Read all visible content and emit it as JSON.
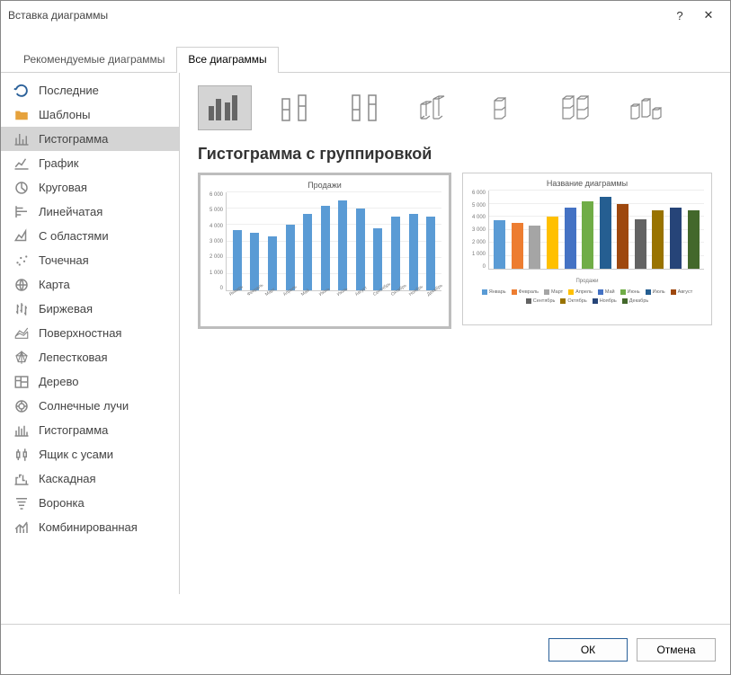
{
  "window": {
    "title": "Вставка диаграммы"
  },
  "tabs": {
    "recommended": "Рекомендуемые диаграммы",
    "all": "Все диаграммы"
  },
  "sidebar": {
    "items": [
      {
        "label": "Последние",
        "icon": "recent"
      },
      {
        "label": "Шаблоны",
        "icon": "templates"
      },
      {
        "label": "Гистограмма",
        "icon": "column",
        "selected": true
      },
      {
        "label": "График",
        "icon": "line"
      },
      {
        "label": "Круговая",
        "icon": "pie"
      },
      {
        "label": "Линейчатая",
        "icon": "bar"
      },
      {
        "label": "С областями",
        "icon": "area"
      },
      {
        "label": "Точечная",
        "icon": "scatter"
      },
      {
        "label": "Карта",
        "icon": "map"
      },
      {
        "label": "Биржевая",
        "icon": "stock"
      },
      {
        "label": "Поверхностная",
        "icon": "surface"
      },
      {
        "label": "Лепестковая",
        "icon": "radar"
      },
      {
        "label": "Дерево",
        "icon": "treemap"
      },
      {
        "label": "Солнечные лучи",
        "icon": "sunburst"
      },
      {
        "label": "Гистограмма",
        "icon": "histogram"
      },
      {
        "label": "Ящик с усами",
        "icon": "boxwhisker"
      },
      {
        "label": "Каскадная",
        "icon": "waterfall"
      },
      {
        "label": "Воронка",
        "icon": "funnel"
      },
      {
        "label": "Комбинированная",
        "icon": "combo"
      }
    ]
  },
  "main": {
    "subtype_title": "Гистограмма с группировкой",
    "preview1_title": "Продажи",
    "preview2_title": "Название диаграммы",
    "preview2_xlabel": "Продажи"
  },
  "footer": {
    "ok": "ОК",
    "cancel": "Отмена"
  },
  "chart_data": [
    {
      "type": "bar",
      "title": "Продажи",
      "categories": [
        "Январь",
        "Февраль",
        "Март",
        "Апрель",
        "Май",
        "Июнь",
        "Июль",
        "Август",
        "Сентябрь",
        "Октябрь",
        "Ноябрь",
        "Декабрь"
      ],
      "values": [
        3700,
        3500,
        3300,
        4000,
        4700,
        5200,
        5500,
        5000,
        3800,
        4500,
        4700,
        4500
      ],
      "ylabel": "",
      "xlabel": "",
      "ylim": [
        0,
        6000
      ],
      "yticks": [
        0,
        1000,
        2000,
        3000,
        4000,
        5000,
        6000
      ],
      "ytick_labels": [
        "0",
        "1 000",
        "2 000",
        "3 000",
        "4 000",
        "5 000",
        "6 000"
      ],
      "color": "#5a9bd5"
    },
    {
      "type": "bar",
      "title": "Название диаграммы",
      "categories": [
        "Продажи"
      ],
      "series": [
        {
          "name": "Январь",
          "value": 3700,
          "color": "#5a9bd5"
        },
        {
          "name": "Февраль",
          "value": 3500,
          "color": "#ed7d31"
        },
        {
          "name": "Март",
          "value": 3300,
          "color": "#a5a5a5"
        },
        {
          "name": "Апрель",
          "value": 4000,
          "color": "#ffc000"
        },
        {
          "name": "Май",
          "value": 4700,
          "color": "#4472c4"
        },
        {
          "name": "Июнь",
          "value": 5200,
          "color": "#70ad47"
        },
        {
          "name": "Июль",
          "value": 5500,
          "color": "#255e91"
        },
        {
          "name": "Август",
          "value": 5000,
          "color": "#9e480e"
        },
        {
          "name": "Сентябрь",
          "value": 3800,
          "color": "#636363"
        },
        {
          "name": "Октябрь",
          "value": 4500,
          "color": "#997300"
        },
        {
          "name": "Ноябрь",
          "value": 4700,
          "color": "#264478"
        },
        {
          "name": "Декабрь",
          "value": 4500,
          "color": "#43682b"
        }
      ],
      "ylim": [
        0,
        6000
      ],
      "yticks": [
        0,
        1000,
        2000,
        3000,
        4000,
        5000,
        6000
      ],
      "ytick_labels": [
        "0",
        "1 000",
        "2 000",
        "3 000",
        "4 000",
        "5 000",
        "6 000"
      ]
    }
  ]
}
